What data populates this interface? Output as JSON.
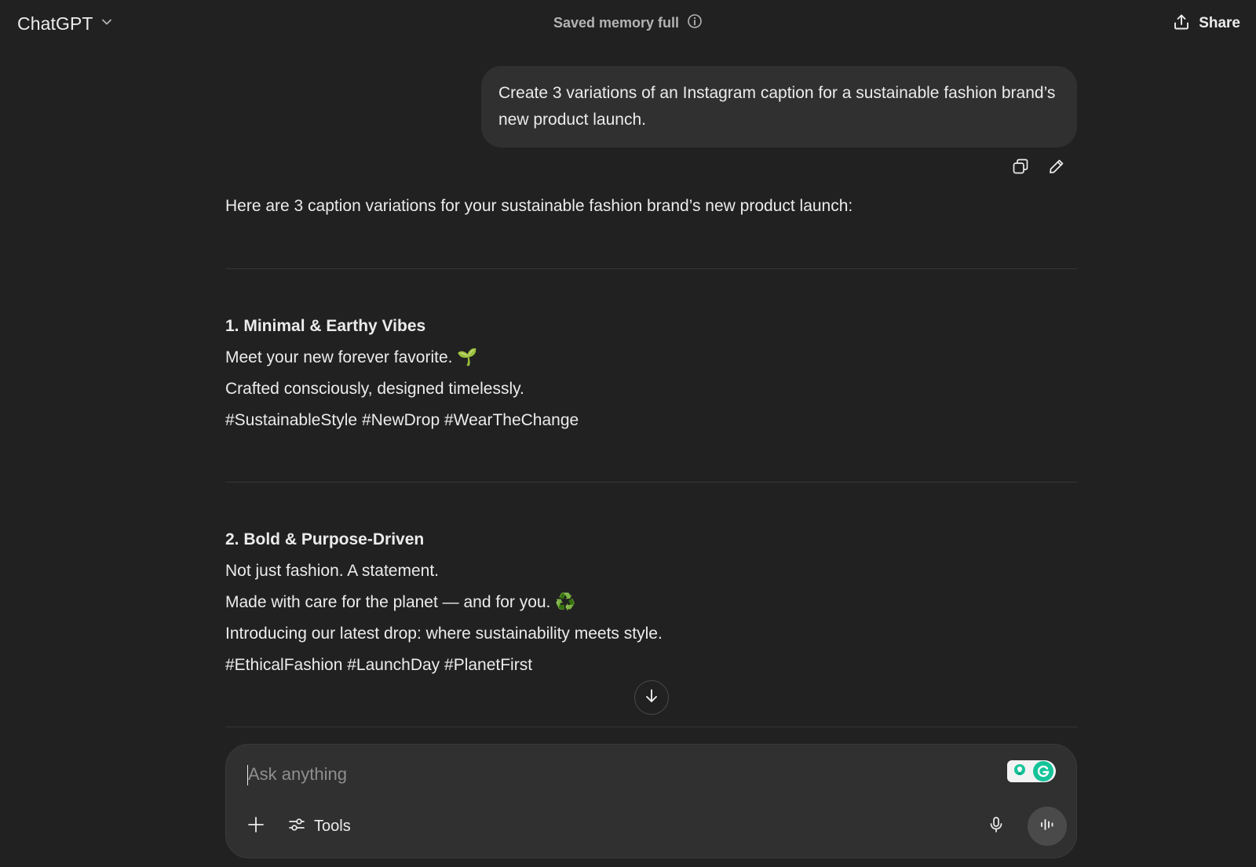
{
  "header": {
    "model_name": "ChatGPT",
    "model_icon": "chevron-down-icon",
    "memory_status": "Saved memory full",
    "memory_icon": "info-icon",
    "share_label": "Share",
    "share_icon": "share-upload-icon"
  },
  "conversation": {
    "user_message": "Create 3 variations of an Instagram caption for a sustainable fashion brand’s new product launch.",
    "user_actions": [
      {
        "name": "copy-icon"
      },
      {
        "name": "edit-pencil-icon"
      }
    ],
    "assistant_intro": "Here are 3 caption variations for your sustainable fashion brand’s new product launch:",
    "captions": [
      {
        "title": "1. Minimal & Earthy Vibes",
        "lines": [
          "Meet your new forever favorite. 🌱",
          "Crafted consciously, designed timelessly.",
          "#SustainableStyle #NewDrop #WearTheChange"
        ]
      },
      {
        "title": "2. Bold & Purpose-Driven",
        "lines": [
          "Not just fashion. A statement.",
          "Made with care for the planet — and for you. ♻️",
          "Introducing our latest drop: where sustainability meets style.",
          "#EthicalFashion #LaunchDay #PlanetFirst"
        ]
      }
    ]
  },
  "composer": {
    "placeholder": "Ask anything",
    "value": "",
    "tools_label": "Tools",
    "icons": {
      "attach": "plus-icon",
      "tools": "sliders-icon",
      "mic": "microphone-icon",
      "voice": "voice-waveform-icon",
      "extension": "grammarly-icon"
    }
  },
  "colors": {
    "background": "#212121",
    "bubble": "#303030",
    "text": "#ececec",
    "muted": "#b4b4b4",
    "emoji_green": "#5cb85c"
  }
}
